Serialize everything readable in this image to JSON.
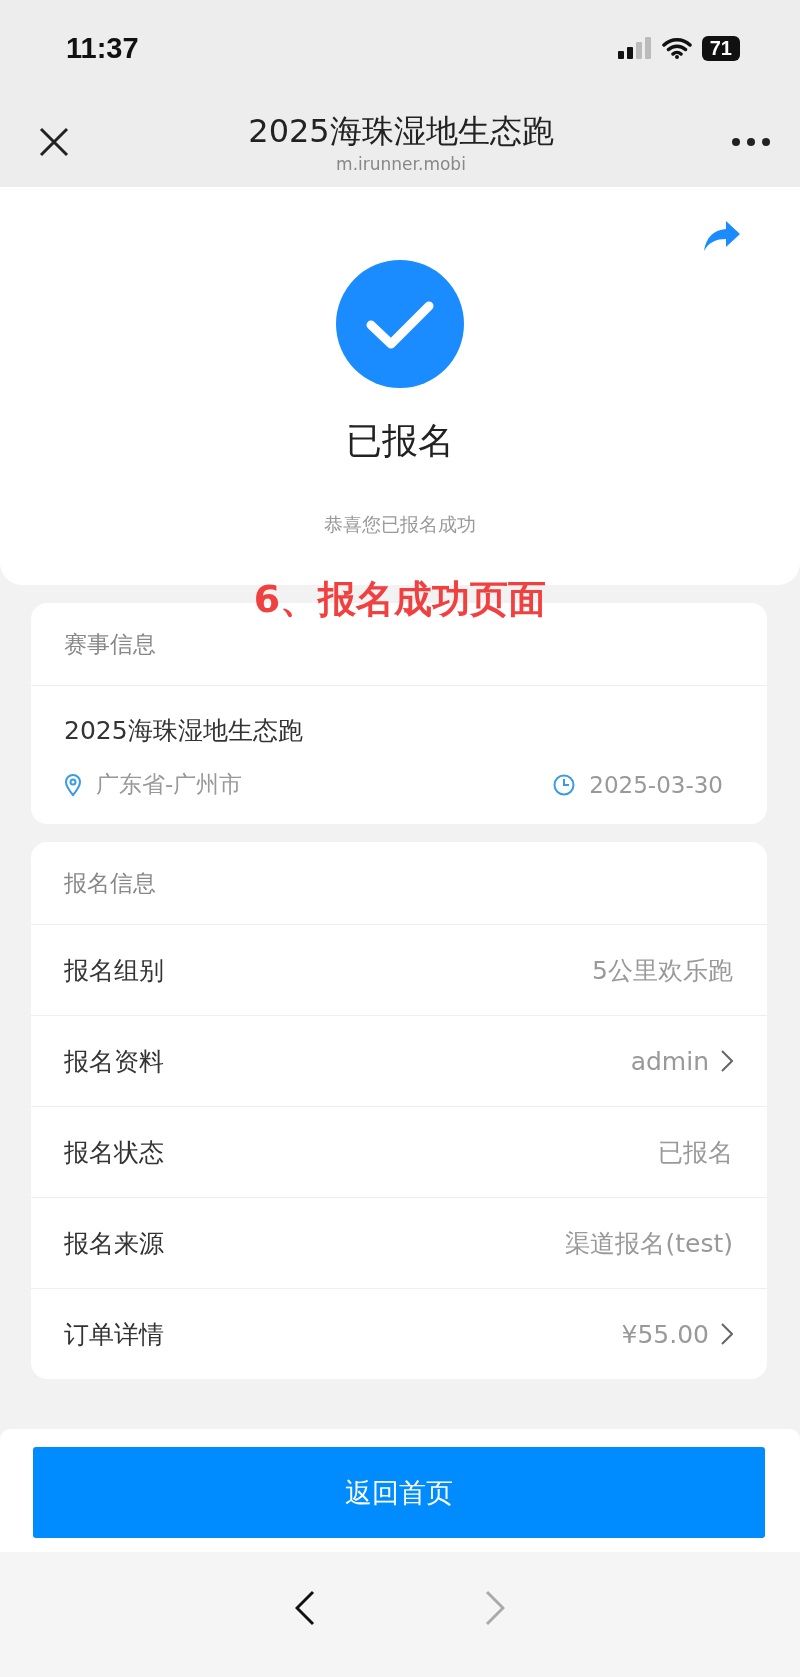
{
  "status_bar": {
    "time": "11:37",
    "battery": "71"
  },
  "header": {
    "title": "2025海珠湿地生态跑",
    "url": "m.irunner.mobi"
  },
  "result": {
    "title": "已报名",
    "subtitle": "恭喜您已报名成功"
  },
  "annotation": "6、报名成功页面",
  "event_card": {
    "heading": "赛事信息",
    "name": "2025海珠湿地生态跑",
    "location": "广东省-广州市",
    "date": "2025-03-30"
  },
  "registration_card": {
    "heading": "报名信息",
    "rows": [
      {
        "label": "报名组别",
        "value": "5公里欢乐跑",
        "chevron": false
      },
      {
        "label": "报名资料",
        "value": "admin",
        "chevron": true
      },
      {
        "label": "报名状态",
        "value": "已报名",
        "chevron": false
      },
      {
        "label": "报名来源",
        "value": "渠道报名(test)",
        "chevron": false
      },
      {
        "label": "订单详情",
        "value": "¥55.00",
        "chevron": true
      }
    ]
  },
  "primary_button": "返回首页",
  "nav": {
    "back_disabled": false,
    "forward_disabled": true
  }
}
